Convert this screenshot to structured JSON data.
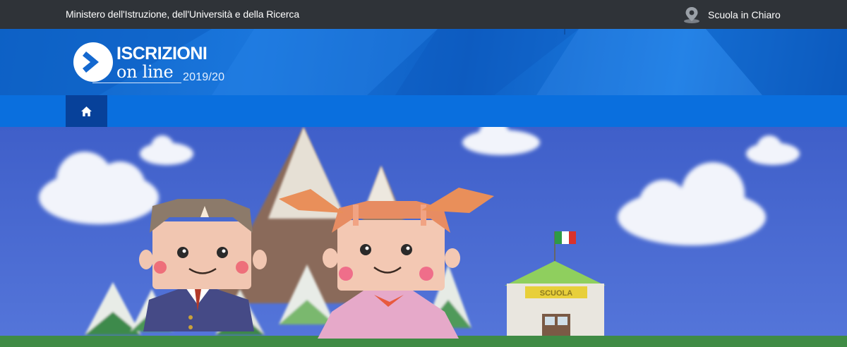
{
  "topbar": {
    "ministry": "Ministero dell'Istruzione, dell'Università e della Ricerca",
    "scuola_link": "Scuola in Chiaro",
    "scuola_icon": "map-pin-icon"
  },
  "logo": {
    "title": "ISCRIZIONI",
    "subtitle": "on line",
    "year": "2019/20",
    "icon": "chevron-right-circle-icon"
  },
  "nav": {
    "home_icon": "home-icon"
  },
  "hero": {
    "sign_text": "SCUOLA",
    "flag_colors": [
      "#2e9a45",
      "#ffffff",
      "#d8322c"
    ]
  },
  "colors": {
    "topbar": "#2f3338",
    "header": "#1570d8",
    "navbar": "#0a6fde",
    "home_active": "#07419a",
    "sky": "#4868d0"
  }
}
